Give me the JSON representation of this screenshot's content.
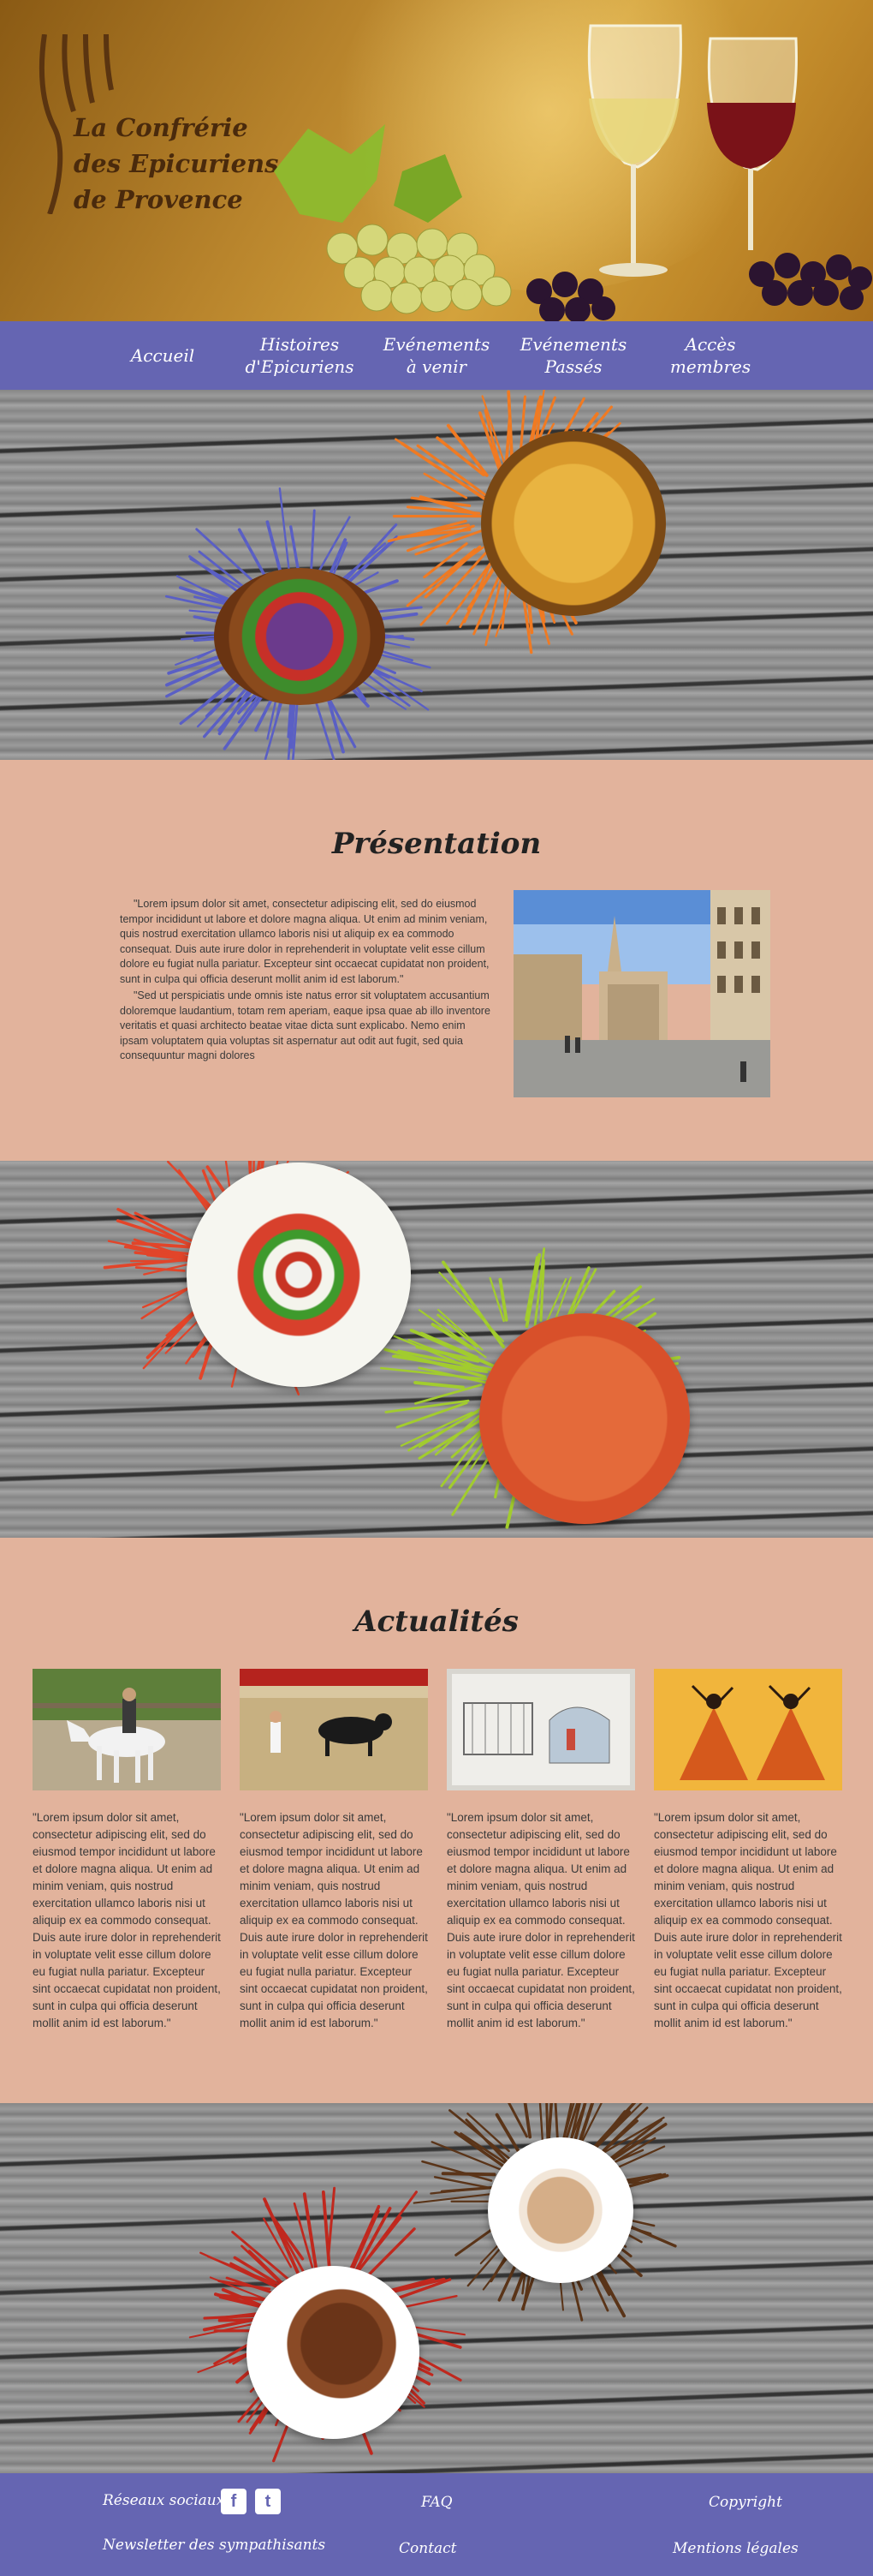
{
  "header": {
    "logo_line1": "La Confrérie",
    "logo_line2": "des Epicuriens",
    "logo_line3": "de Provence"
  },
  "nav": {
    "items": [
      {
        "line1": "Accueil",
        "line2": ""
      },
      {
        "line1": "Histoires",
        "line2": "d'Epicuriens"
      },
      {
        "line1": "Evénements",
        "line2": "à venir"
      },
      {
        "line1": "Evénements",
        "line2": "Passés"
      },
      {
        "line1": "Accès",
        "line2": "membres"
      }
    ]
  },
  "presentation": {
    "title": "Présentation",
    "para1": "\"Lorem ipsum dolor sit amet, consectetur adipiscing elit, sed do eiusmod tempor incididunt ut labore et dolore magna aliqua. Ut enim ad minim veniam, quis nostrud exercitation ullamco laboris nisi ut aliquip ex ea commodo consequat. Duis aute irure dolor in reprehenderit in voluptate velit esse cillum dolore eu fugiat nulla pariatur. Excepteur sint occaecat cupidatat non proident, sunt in culpa qui officia deserunt mollit anim id est laborum.\"",
    "para2": "\"Sed ut perspiciatis unde omnis iste natus error sit voluptatem accusantium doloremque laudantium, totam rem aperiam, eaque ipsa quae ab illo inventore veritatis et quasi architecto beatae vitae dicta sunt explicabo. Nemo enim ipsam voluptatem quia voluptas sit aspernatur aut odit aut fugit, sed quia consequuntur magni dolores"
  },
  "actualites": {
    "title": "Actualités",
    "cards": [
      {
        "text": "\"Lorem ipsum dolor sit amet, consectetur adipiscing elit, sed do eiusmod tempor incididunt ut labore et dolore magna aliqua. Ut enim ad minim veniam, quis nostrud exercitation ullamco laboris nisi ut aliquip ex ea commodo consequat. Duis aute irure dolor in reprehenderit in voluptate velit esse cillum dolore eu fugiat nulla pariatur. Excepteur sint occaecat cupidatat non proident, sunt in culpa qui officia deserunt mollit anim id est laborum.\""
      },
      {
        "text": "\"Lorem ipsum dolor sit amet, consectetur adipiscing elit, sed do eiusmod tempor incididunt ut labore et dolore magna aliqua. Ut enim ad minim veniam, quis nostrud exercitation ullamco laboris nisi ut aliquip ex ea commodo consequat. Duis aute irure dolor in reprehenderit in voluptate velit esse cillum dolore eu fugiat nulla pariatur. Excepteur sint occaecat cupidatat non proident, sunt in culpa qui officia deserunt mollit anim id est laborum.\""
      },
      {
        "text": "\"Lorem ipsum dolor sit amet, consectetur adipiscing elit, sed do eiusmod tempor incididunt ut labore et dolore magna aliqua. Ut enim ad minim veniam, quis nostrud exercitation ullamco laboris nisi ut aliquip ex ea commodo consequat. Duis aute irure dolor in reprehenderit in voluptate velit esse cillum dolore eu fugiat nulla pariatur. Excepteur sint occaecat cupidatat non proident, sunt in culpa qui officia deserunt mollit anim id est laborum.\""
      },
      {
        "text": "\"Lorem ipsum dolor sit amet, consectetur adipiscing elit, sed do eiusmod tempor incididunt ut labore et dolore magna aliqua. Ut enim ad minim veniam, quis nostrud exercitation ullamco laboris nisi ut aliquip ex ea commodo consequat. Duis aute irure dolor in reprehenderit in voluptate velit esse cillum dolore eu fugiat nulla pariatur. Excepteur sint occaecat cupidatat non proident, sunt in culpa qui officia deserunt mollit anim id est laborum.\""
      }
    ]
  },
  "footer": {
    "social_label": "Réseaux sociaux",
    "facebook_glyph": "f",
    "twitter_glyph": "t",
    "newsletter": "Newsletter des sympathisants",
    "faq": "FAQ",
    "contact": "Contact",
    "copyright": "Copyright",
    "legal": "Mentions légales"
  },
  "colors": {
    "nav_bg": "#6565b2",
    "content_bg": "#e2b39c",
    "burst_blue": "#5a5fc4",
    "burst_orange": "#f07a22",
    "burst_red": "#e2452a",
    "burst_green": "#a2cc2e",
    "burst_dark_red": "#c0281e",
    "burst_brown": "#5a3418"
  }
}
